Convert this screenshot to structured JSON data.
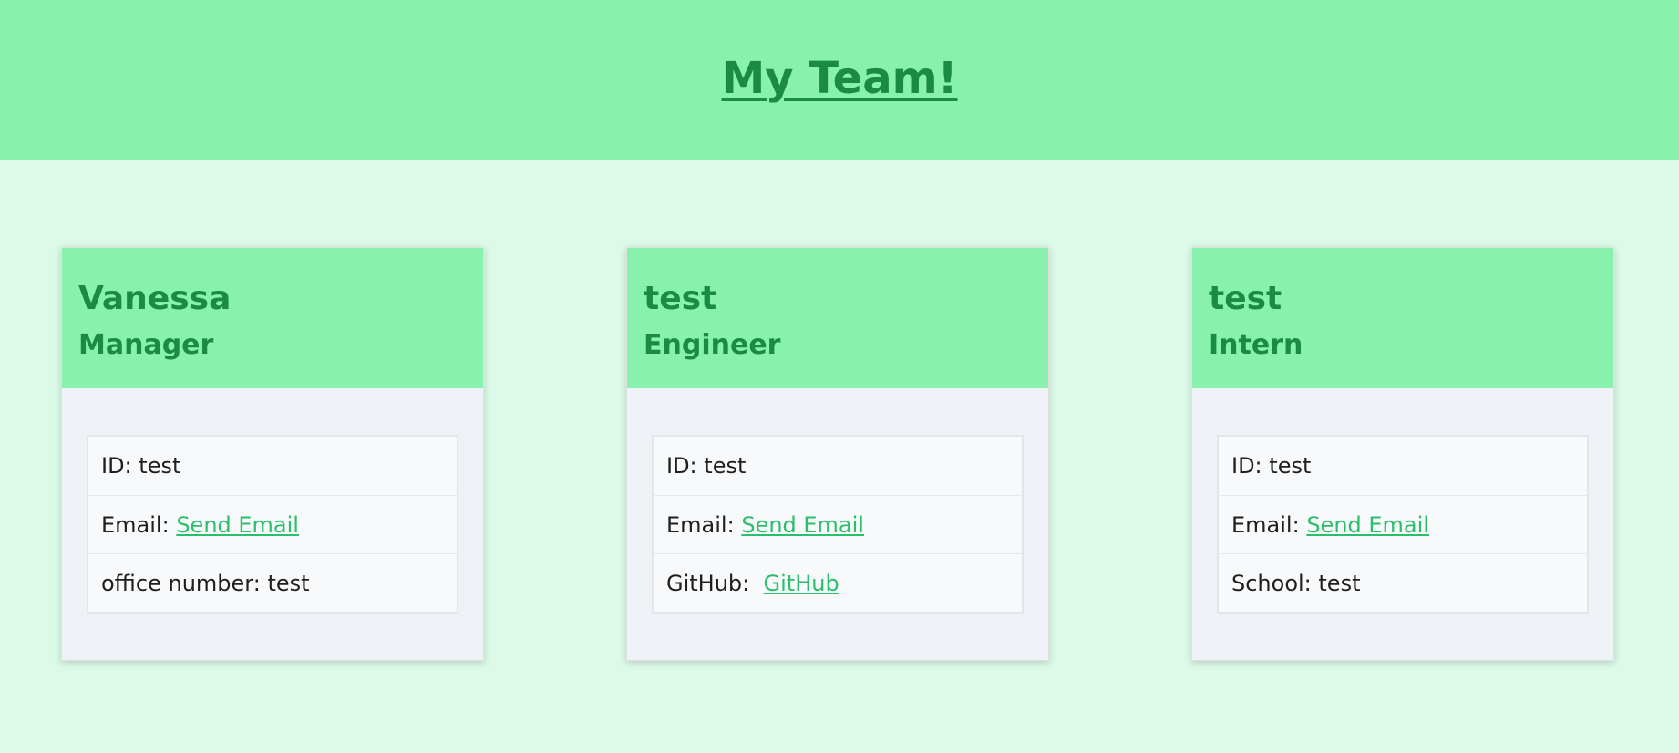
{
  "page": {
    "title": "My Team!"
  },
  "cards": [
    {
      "name": "Vanessa",
      "role": "Manager",
      "rows": [
        {
          "label": "ID: ",
          "value": "test"
        },
        {
          "label": "Email: ",
          "link": "Send Email"
        },
        {
          "label": "office number: ",
          "value": "test"
        }
      ]
    },
    {
      "name": "test",
      "role": "Engineer",
      "rows": [
        {
          "label": "ID: ",
          "value": "test"
        },
        {
          "label": "Email: ",
          "link": "Send Email"
        },
        {
          "label": "GitHub:  ",
          "link": "GitHub"
        }
      ]
    },
    {
      "name": "test",
      "role": "Intern",
      "rows": [
        {
          "label": "ID: ",
          "value": "test"
        },
        {
          "label": "Email: ",
          "link": "Send Email"
        },
        {
          "label": "School: ",
          "value": "test"
        }
      ]
    }
  ],
  "colors": {
    "background": "#dcfae8",
    "header": "#87f1ad",
    "title_text": "#1b8a44",
    "link": "#2abf6a",
    "card_body": "#eef2f7"
  }
}
